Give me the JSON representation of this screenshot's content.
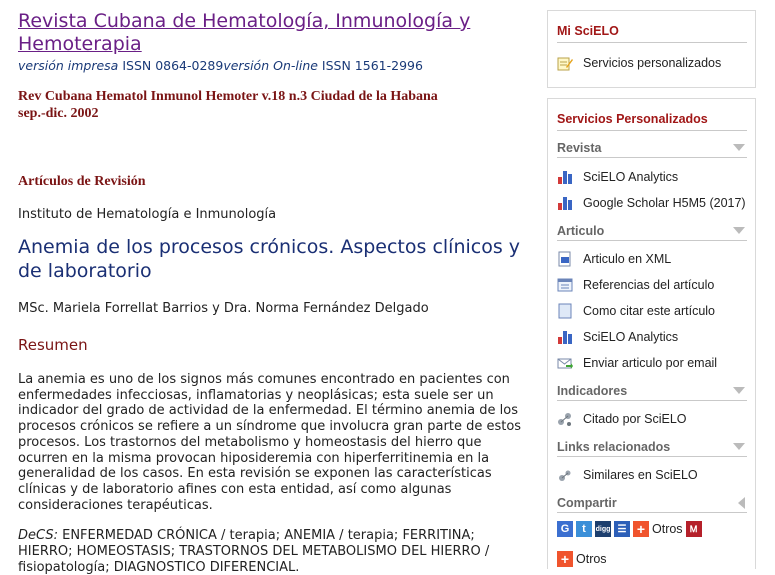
{
  "journal": {
    "title": "Revista Cubana de Hematología, Inmunología y Hemoterapia",
    "issn_print_label": "versión impresa",
    "issn_print": " ISSN 0864-0289",
    "issn_online_label": "versión On-line",
    "issn_online": " ISSN 1561-2996",
    "citation": "Rev Cubana Hematol Inmunol Hemoter v.18 n.3 Ciudad de la Habana sep.-dic. 2002"
  },
  "article": {
    "section": "Artículos de Revisión",
    "institution": "Instituto de Hematología e Inmunología",
    "title": "Anemia de los procesos crónicos. Aspectos clínicos y de laboratorio",
    "authors": "MSc. Mariela Forrellat Barrios y Dra. Norma Fernández Delgado",
    "resumen_heading": "Resumen",
    "abstract": "La anemia es uno de los signos más comunes encontrado en pacientes con enfermedades infecciosas, inflamatorias y neoplásicas; esta suele ser un indicador del grado de actividad de la enfermedad. El término anemia de los procesos crónicos se refiere a un síndrome que involucra gran parte de estos procesos. Los trastornos del metabolismo y homeostasis del hierro que ocurren en la misma provocan hiposideremia con hiperferritinemia en la generalidad de los casos. En esta revisión se exponen las características clínicas y de laboratorio afines con esta entidad, así como algunas consideraciones terapéuticas.",
    "decs_label": "DeCS:",
    "decs": " ENFERMEDAD CRÓNICA / terapia; ANEMIA / terapia; FERRITINA; HIERRO; HOMEOSTASIS; TRASTORNOS DEL METABOLISMO DEL HIERRO / fisiopatología; DIAGNOSTICO DIFERENCIAL."
  },
  "sidebar": {
    "mi_scielo": {
      "title": "Mi SciELO",
      "item": "Servicios personalizados"
    },
    "servicios": {
      "title": "Servicios Personalizados",
      "revista_label": "Revista",
      "revista_items": [
        "SciELO Analytics",
        "Google Scholar H5M5 (2017)"
      ],
      "articulo_label": "Articulo",
      "articulo_items": [
        "Articulo en XML",
        "Referencias del artículo",
        "Como citar este artículo",
        "SciELO Analytics",
        "Enviar articulo por email"
      ],
      "indicadores_label": "Indicadores",
      "indicadores_items": [
        "Citado por SciELO"
      ],
      "links_label": "Links relacionados",
      "links_items": [
        "Similares en SciELO"
      ],
      "compartir_label": "Compartir",
      "share_icons": [
        "google-icon",
        "twitter-icon",
        "digg-icon",
        "stumble-icon",
        "addthis-icon",
        "mendeley-icon"
      ],
      "share_more": "Otros",
      "share_more2": "Otros"
    }
  },
  "colors": {
    "journal_link": "#6a1f86",
    "heading_red": "#7a1414",
    "article_title": "#1a2f74",
    "sidebar_title": "#a11717"
  }
}
